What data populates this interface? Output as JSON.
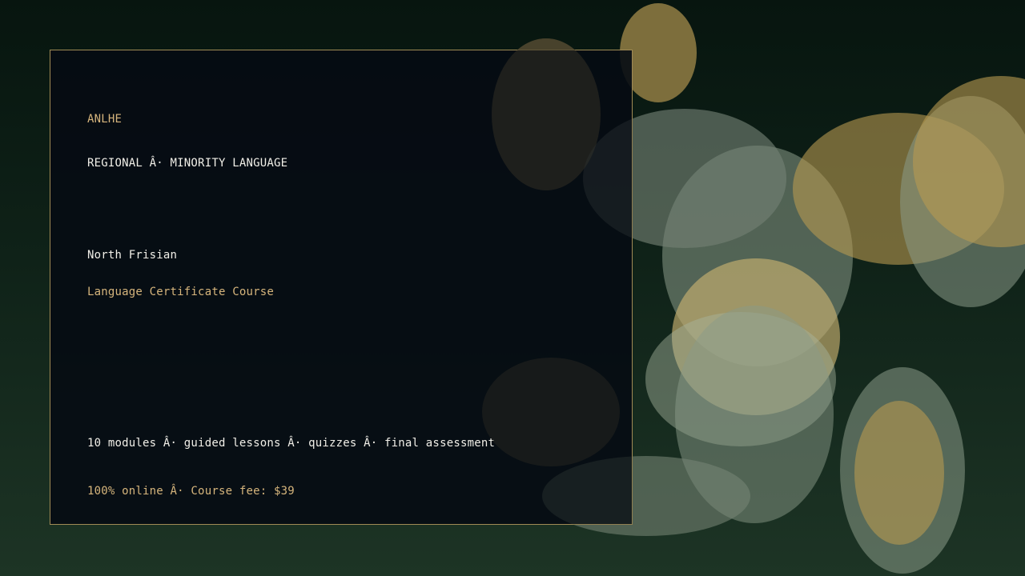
{
  "colors": {
    "background_top": "#07150f",
    "background_bottom": "#1d3425",
    "panel_background": "#050b13",
    "panel_border": "#a08a55",
    "accent_gold": "#d6b57c",
    "text_white": "#f1efe8",
    "bokeh_gold": "#b89a50",
    "bokeh_sage": "#8a9a85",
    "bokeh_dark": "#2a2a22"
  },
  "brand": "ANLHE",
  "category": "REGIONAL Â· MINORITY LANGUAGE",
  "course": {
    "name": "North Frisian",
    "type": "Language Certificate Course"
  },
  "details": "10 modules Â· guided lessons Â· quizzes Â· final assessment",
  "pricing": "100% online Â· Course fee: $39"
}
